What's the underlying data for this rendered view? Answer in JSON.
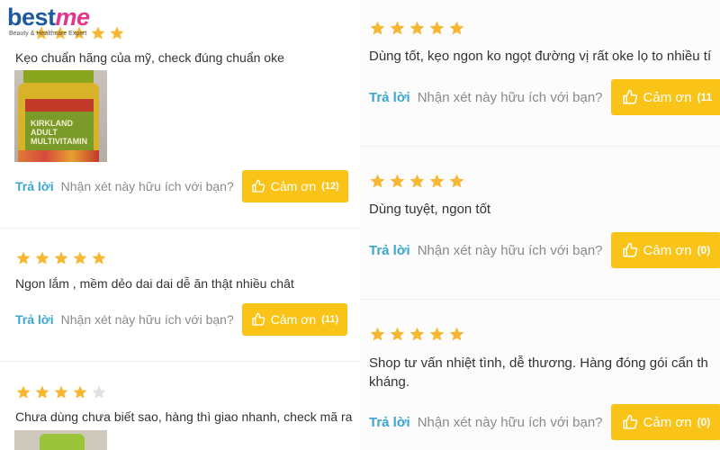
{
  "brand": {
    "name_part1": "best",
    "name_part2": "me",
    "tagline": "Beauty & Healthcare Expert"
  },
  "colors": {
    "star_filled": "#f7b733",
    "star_empty": "#e0e0e0",
    "reply": "#3aa6d0",
    "thanks_button": "#f9c417",
    "logo_blue": "#1d5a9e",
    "logo_pink": "#e0368c"
  },
  "labels": {
    "reply": "Trả lời",
    "helpful_question": "Nhận xét này hữu ích với bạn?",
    "thanks": "Cảm ơn"
  },
  "reviews_left": [
    {
      "rating": 5,
      "text": "Kẹo chuẩn hãng của mỹ, check đúng chuẩn  oke",
      "has_photo": true,
      "photo_text": "KIRKLAND ADULT MULTIVITAMIN",
      "thanks_count": "(12)"
    },
    {
      "rating": 5,
      "text": "Ngon lắm , mềm dẻo dai dai dễ ăn thật nhiều chât",
      "has_photo": false,
      "thanks_count": "(11)"
    },
    {
      "rating": 4,
      "text": "Chưa dùng chưa biết sao, hàng thì giao nhanh, check mã ra",
      "has_photo": true
    }
  ],
  "reviews_right": [
    {
      "rating": 5,
      "text": "Dùng tốt, kẹo ngon ko ngọt đường vị rất oke lọ to nhiều tí",
      "thanks_count": "(11"
    },
    {
      "rating": 5,
      "text": "Dùng tuyệt, ngon tốt",
      "thanks_count": "(0)"
    },
    {
      "rating": 5,
      "text_line1": "Shop tư vấn nhiệt tình, dễ thương. Hàng đóng gói cẩn th",
      "text_line2": "kháng.",
      "thanks_count": "(0)"
    }
  ]
}
